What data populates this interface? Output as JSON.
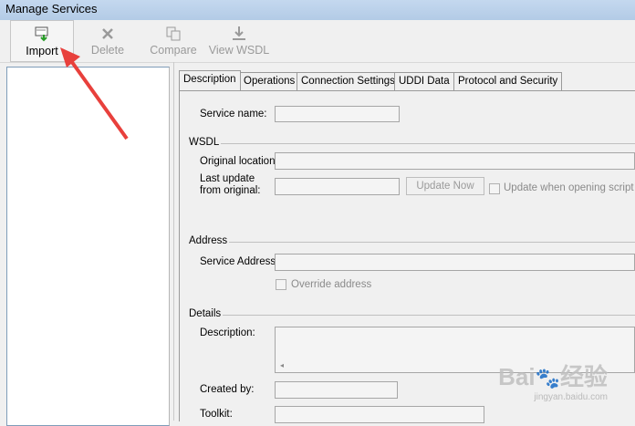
{
  "window": {
    "title": "Manage Services"
  },
  "toolbar": {
    "import_label": "Import",
    "delete_label": "Delete",
    "compare_label": "Compare",
    "view_wsdl_label": "View WSDL"
  },
  "tabs": [
    "Description",
    "Operations",
    "Connection Settings",
    "UDDI Data",
    "Protocol and Security"
  ],
  "description": {
    "service_name_label": "Service name:",
    "wsdl_group": "WSDL",
    "original_location_label": "Original location:",
    "last_update_label_line1": "Last update",
    "last_update_label_line2": "from original:",
    "update_now_button": "Update Now",
    "update_when_opening_label": "Update when opening script",
    "address_group": "Address",
    "service_address_label": "Service Address:",
    "override_address_label": "Override address",
    "details_group": "Details",
    "description_label": "Description:",
    "created_by_label": "Created by:",
    "toolkit_label": "Toolkit:"
  },
  "watermark": {
    "brand": "Bai",
    "brand_tail": "经验",
    "site": "jingyan.baidu.com"
  },
  "colors": {
    "annotation_arrow": "#e8403c",
    "import_icon": "#2a9d2a"
  }
}
